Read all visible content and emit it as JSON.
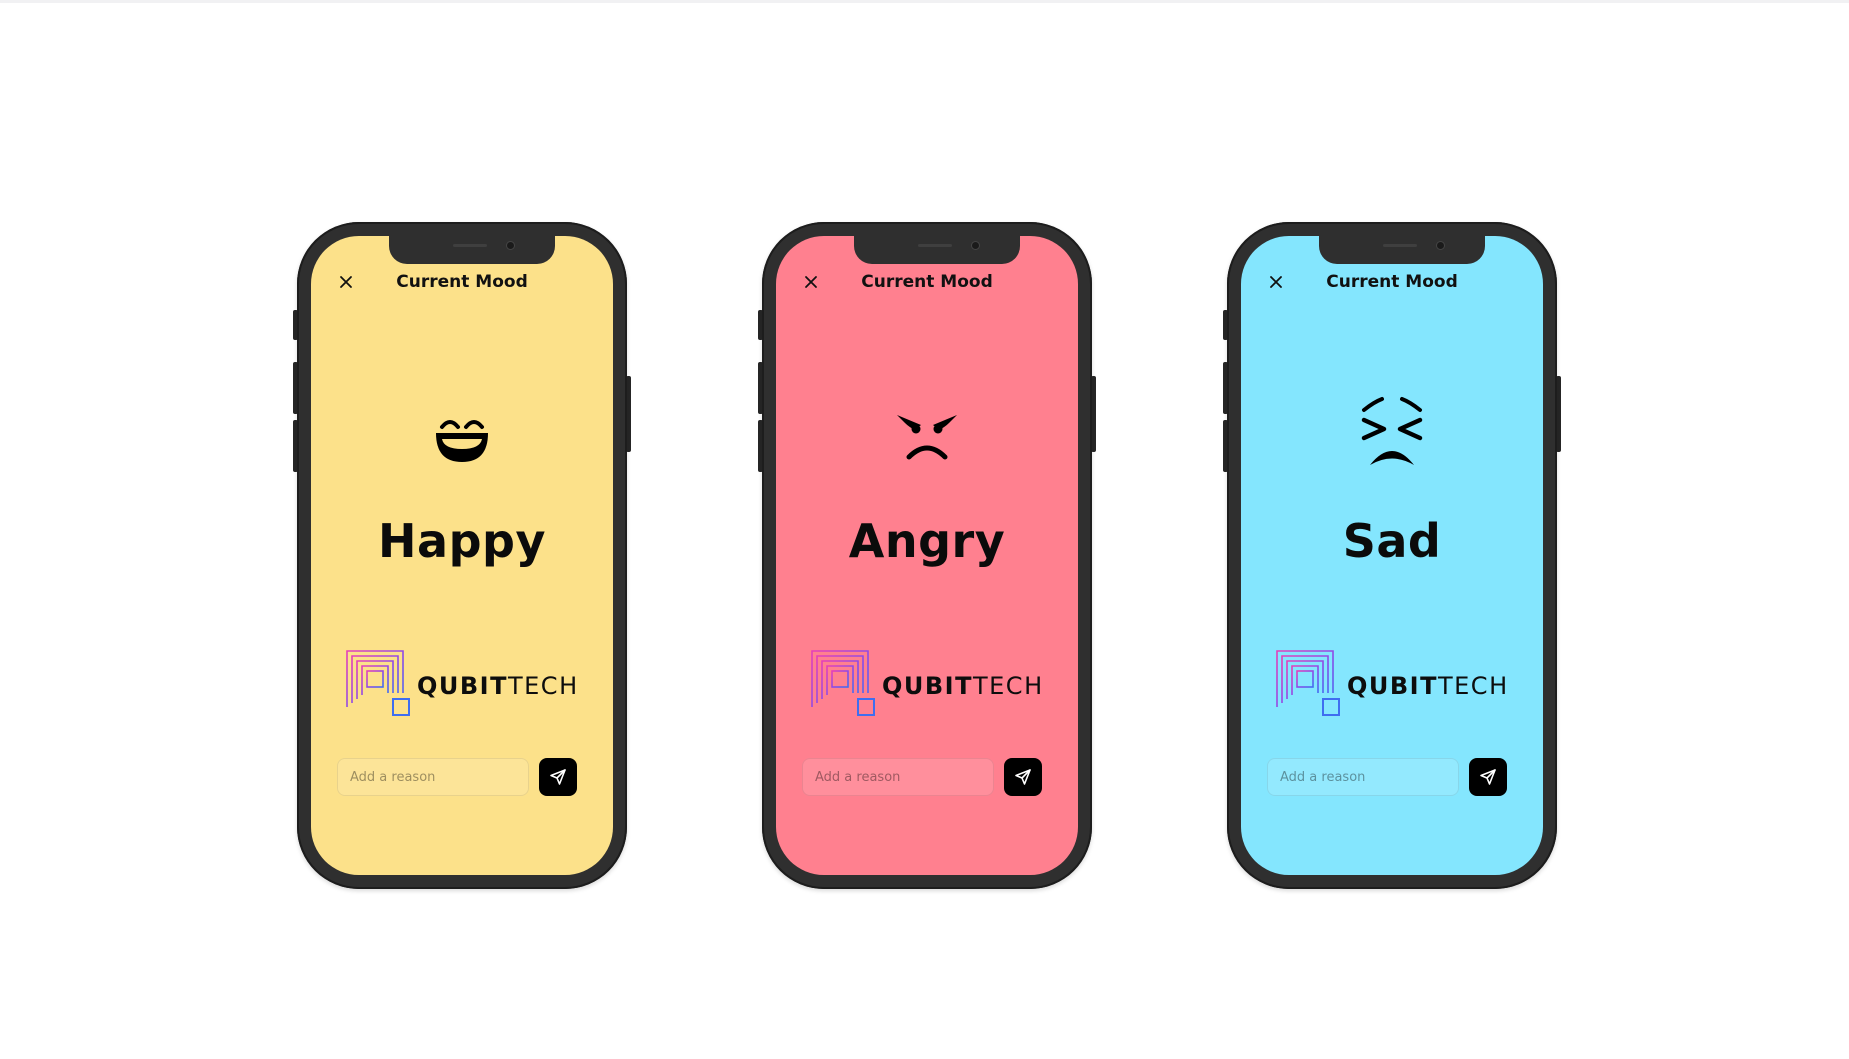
{
  "phones": [
    {
      "id": "happy",
      "title": "Current Mood",
      "mood": "Happy",
      "emoji_icon": "grinning-face-icon",
      "screen_color": "#FCE18A",
      "brand": {
        "bold": "QUBIT",
        "light": "TECH"
      },
      "input_placeholder": "Add a reason",
      "send_icon": "send-icon",
      "close_icon": "close-icon"
    },
    {
      "id": "angry",
      "title": "Current Mood",
      "mood": "Angry",
      "emoji_icon": "angry-face-icon",
      "screen_color": "#FF808F",
      "brand": {
        "bold": "QUBIT",
        "light": "TECH"
      },
      "input_placeholder": "Add a reason",
      "send_icon": "send-icon",
      "close_icon": "close-icon"
    },
    {
      "id": "sad",
      "title": "Current Mood",
      "mood": "Sad",
      "emoji_icon": "persevering-face-icon",
      "screen_color": "#84E6FE",
      "brand": {
        "bold": "QUBIT",
        "light": "TECH"
      },
      "input_placeholder": "Add a reason",
      "send_icon": "send-icon",
      "close_icon": "close-icon"
    }
  ],
  "colors": {
    "frame": "#2F2F2F",
    "send_button": "#000000",
    "logo_gradient": [
      "#E63FB9",
      "#8A4BE8",
      "#3F6EF0"
    ]
  }
}
